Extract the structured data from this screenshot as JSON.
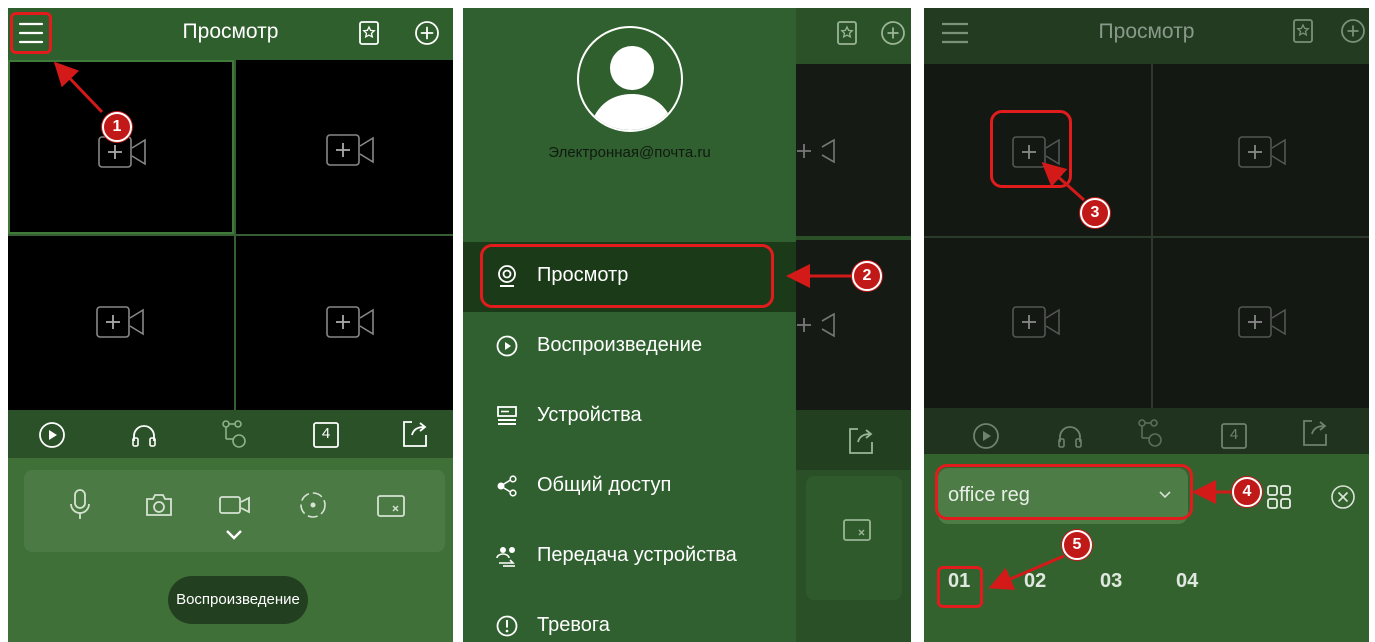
{
  "panel1": {
    "title": "Просмотр",
    "header_icons": [
      "menu-icon",
      "favorites-star-icon",
      "add-circle-icon"
    ],
    "grid_cells": [
      "add-camera",
      "add-camera",
      "add-camera",
      "add-camera"
    ],
    "toolbar_icons": [
      "play-icon",
      "headphones-icon",
      "ptz-icon",
      "layout-4-icon",
      "share-icon"
    ],
    "layout_count": "4",
    "control_icons": [
      "microphone-icon",
      "snapshot-icon",
      "record-icon",
      "ptz-direction-icon",
      "close-window-icon",
      "chevron-down-icon"
    ],
    "playback_button": "Воспроизведение"
  },
  "panel2": {
    "email": "Электронная@почта.ru",
    "menu": [
      {
        "label": "Просмотр",
        "icon": "camera-icon",
        "active": true
      },
      {
        "label": "Воспроизведение",
        "icon": "play-circle-icon",
        "active": false
      },
      {
        "label": "Устройства",
        "icon": "devices-icon",
        "active": false
      },
      {
        "label": "Общий доступ",
        "icon": "share-icon",
        "active": false
      },
      {
        "label": "Передача устройства",
        "icon": "transfer-icon",
        "active": false
      },
      {
        "label": "Тревога",
        "icon": "alarm-icon",
        "active": false
      }
    ]
  },
  "panel3": {
    "title": "Просмотр",
    "device_select": "office reg",
    "layout_count": "4",
    "channels": [
      "01",
      "02",
      "03",
      "04"
    ],
    "selected_channel": "01"
  },
  "annotations": [
    "1",
    "2",
    "3",
    "4",
    "5"
  ],
  "colors": {
    "header": "#2f5f2c",
    "panel_green": "#41733d",
    "highlight_red": "#e21c1c",
    "badge_red": "#c11818"
  }
}
